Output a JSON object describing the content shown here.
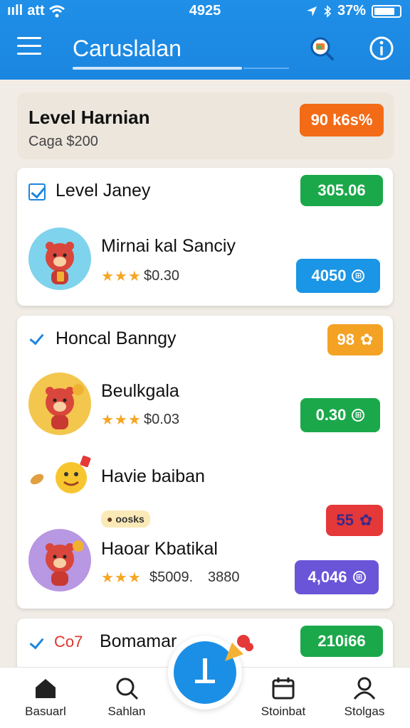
{
  "status": {
    "carrier": "ııll",
    "network": "att",
    "time": "4925",
    "battery": "37%"
  },
  "header": {
    "title": "Caruslalan",
    "search_icon": "search-icon",
    "info_icon": "info-icon"
  },
  "summary": {
    "title": "Level Harnian",
    "subtitle": "Caga $200",
    "badge": "90 k6s%",
    "badge_color": "#f36b17"
  },
  "sections": [
    {
      "title": "Level Janey",
      "badge": "305.06",
      "badge_color": "#1ba84a",
      "items": [
        {
          "name": "Mirnai kal Sanciy",
          "rating": "★★★",
          "price": "$0.30",
          "button": "4050",
          "button_color": "#1b95e6"
        }
      ]
    },
    {
      "title": "Honcal Banngy",
      "badge": "98",
      "badge_color": "#f4a224",
      "items": [
        {
          "name": "Beulkgala",
          "rating": "★★★",
          "price": "$0.03",
          "button": "0.30",
          "button_color": "#1ba84a"
        },
        {
          "name": "Havie baiban"
        },
        {
          "tag": "oosks",
          "name": "Haoar Kbatikal",
          "rating": "★★★",
          "price": "$5009.",
          "extra": "3880",
          "button": "4,046",
          "button_color": "#6a55d8",
          "pill": "55",
          "pill_color": "#e53838"
        }
      ]
    },
    {
      "prefix": "Co7",
      "title": "Bomamar",
      "badge": "210i66",
      "badge_color": "#1ba84a"
    }
  ],
  "nav": [
    {
      "label": "Basuarl",
      "icon": "home-icon"
    },
    {
      "label": "Sahlan",
      "icon": "search-icon"
    },
    {
      "label": "Stoinbat",
      "icon": "calendar-icon"
    },
    {
      "label": "Stolgas",
      "icon": "profile-icon"
    }
  ],
  "fab": {
    "icon": "plus-icon"
  }
}
